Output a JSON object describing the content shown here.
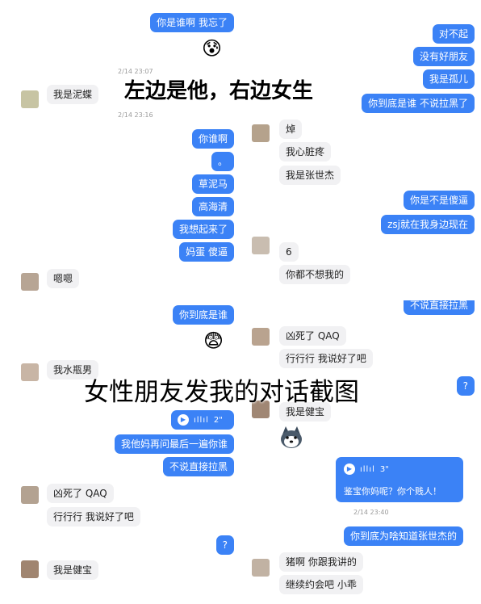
{
  "q1": {
    "r1": "你是谁啊 我忘了",
    "emoji1": "😰",
    "ts1": "2/14 23:07",
    "l1": "我是泥蝶",
    "ts2": "2/14 23:16",
    "r2": "你谁啊",
    "r3": "。",
    "r4": "草泥马",
    "r5": "高海清",
    "r6": "我想起来了",
    "r7": "妈蛋 傻逼",
    "l2": "嗯嗯"
  },
  "q2": {
    "r1": "对不起",
    "r2": "没有好朋友",
    "r3": "我是孤儿",
    "r4": "你到底是谁 不说拉黑了",
    "l1": "焯",
    "l2": "我心脏疼",
    "l3": "我是张世杰",
    "r5": "你是不是傻逼",
    "r6": "zsj就在我身边现在",
    "l4": "6",
    "l5": "你都不想我的"
  },
  "q3": {
    "r1": "你到底是谁",
    "emoji1": "😨",
    "l1": "我水瓶男",
    "voice_duration": "2\"",
    "r2": "我他妈再问最后一遍你谁",
    "r3": "不说直接拉黑",
    "l2": "凶死了 QAQ",
    "l3": "行行行 我说好了吧",
    "r4": "?",
    "l4": "我是健宝"
  },
  "q4": {
    "r0": "不说直接拉黑",
    "l1": "凶死了 QAQ",
    "l2": "行行行 我说好了吧",
    "r1": "?",
    "l3": "我是健宝",
    "voice_duration": "3\"",
    "voice_text": "鉴宝你妈呢？你个贱人！",
    "ts1": "2/14 23:40",
    "r2": "你到底为啥知道张世杰的",
    "l4": "猪啊 你跟我讲的",
    "l5": "继续约会吧 小乖"
  },
  "overlays": {
    "top": "左边是他，右边女生",
    "middle": "女性朋友发我的对话截图"
  }
}
